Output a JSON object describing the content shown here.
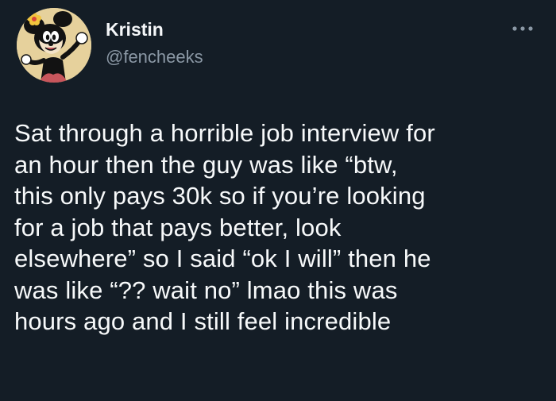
{
  "author": {
    "display_name": "Kristin",
    "handle": "@fencheeks",
    "avatar_icon": "cartoon-character-avatar"
  },
  "menu": {
    "icon": "more-options-icon"
  },
  "tweet": {
    "lines": [
      "Sat through a horrible job interview for",
      "an hour then the guy was like “btw,",
      "this only pays 30k so if you’re looking",
      "for a job that pays better, look",
      "elsewhere” so I said “ok I will” then he",
      "was like “?? wait no” lmao this was",
      "hours ago and I still feel incredible"
    ]
  },
  "colors": {
    "background": "#141d26",
    "text": "#f7f9fa",
    "handle": "#8b98a5"
  }
}
